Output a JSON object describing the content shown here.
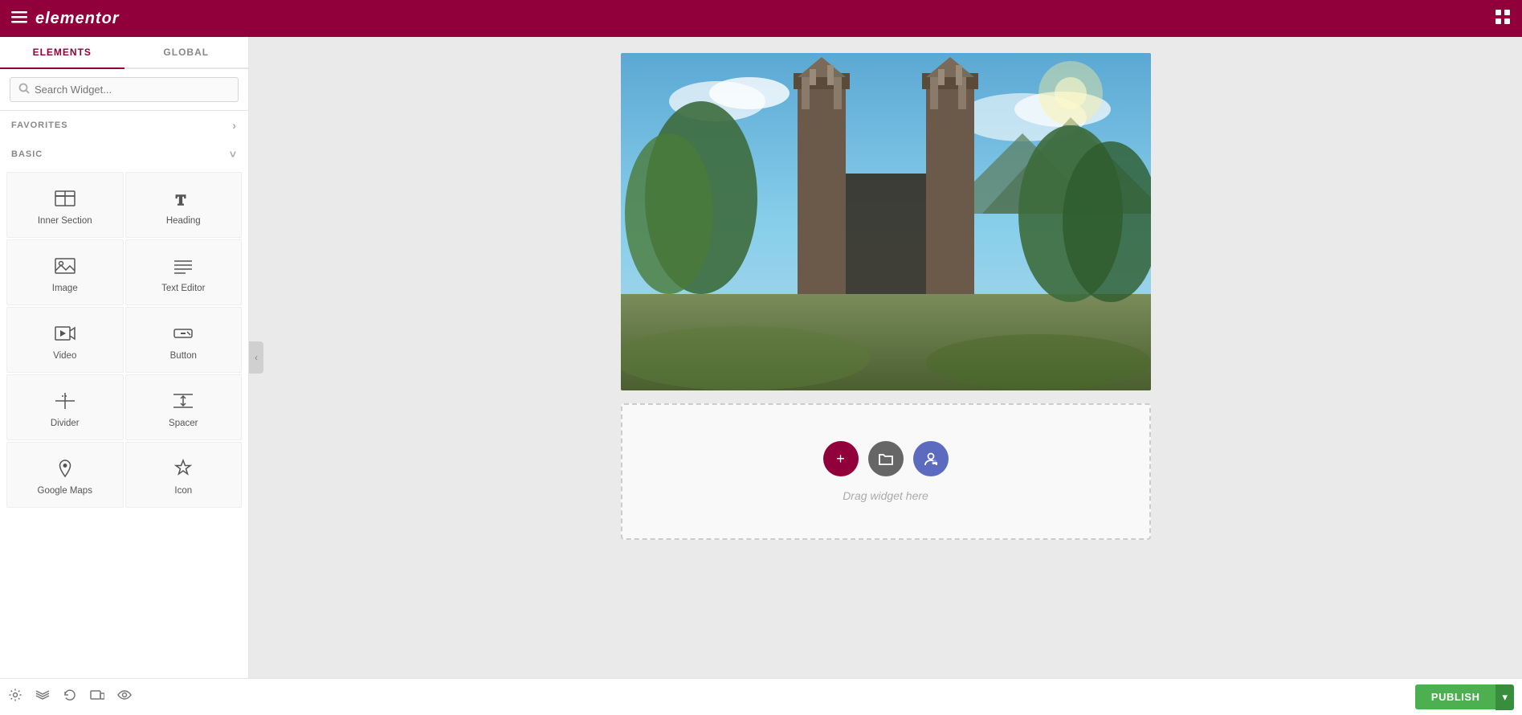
{
  "header": {
    "logo": "elementor",
    "hamburger_aria": "hamburger-menu",
    "grid_aria": "apps-grid"
  },
  "tabs": [
    {
      "id": "elements",
      "label": "ELEMENTS",
      "active": true
    },
    {
      "id": "global",
      "label": "GLOBAL",
      "active": false
    }
  ],
  "search": {
    "placeholder": "Search Widget..."
  },
  "sections": {
    "favorites": {
      "label": "FAVORITES",
      "collapsed": true
    },
    "basic": {
      "label": "BASIC",
      "collapsed": false
    }
  },
  "widgets": [
    {
      "id": "inner-section",
      "label": "Inner Section",
      "icon": "inner-section-icon"
    },
    {
      "id": "heading",
      "label": "Heading",
      "icon": "heading-icon"
    },
    {
      "id": "image",
      "label": "Image",
      "icon": "image-icon"
    },
    {
      "id": "text-editor",
      "label": "Text Editor",
      "icon": "text-editor-icon"
    },
    {
      "id": "video",
      "label": "Video",
      "icon": "video-icon"
    },
    {
      "id": "button",
      "label": "Button",
      "icon": "button-icon"
    },
    {
      "id": "divider",
      "label": "Divider",
      "icon": "divider-icon"
    },
    {
      "id": "spacer",
      "label": "Spacer",
      "icon": "spacer-icon"
    },
    {
      "id": "google-maps",
      "label": "Google Maps",
      "icon": "google-maps-icon"
    },
    {
      "id": "icon",
      "label": "Icon",
      "icon": "icon-widget-icon"
    }
  ],
  "bottom_toolbar": {
    "icons": [
      {
        "id": "settings",
        "label": "Settings"
      },
      {
        "id": "layers",
        "label": "Layers"
      },
      {
        "id": "history",
        "label": "History"
      },
      {
        "id": "responsive",
        "label": "Responsive"
      },
      {
        "id": "eye",
        "label": "Preview"
      }
    ],
    "publish_label": "PUBLISH"
  },
  "canvas": {
    "drop_zone": {
      "text": "Drag widget here",
      "buttons": [
        {
          "id": "add",
          "label": "+",
          "color": "#92003b"
        },
        {
          "id": "folder",
          "label": "⬚",
          "color": "#666"
        },
        {
          "id": "user",
          "label": "☺",
          "color": "#5c6bc0"
        }
      ]
    }
  }
}
